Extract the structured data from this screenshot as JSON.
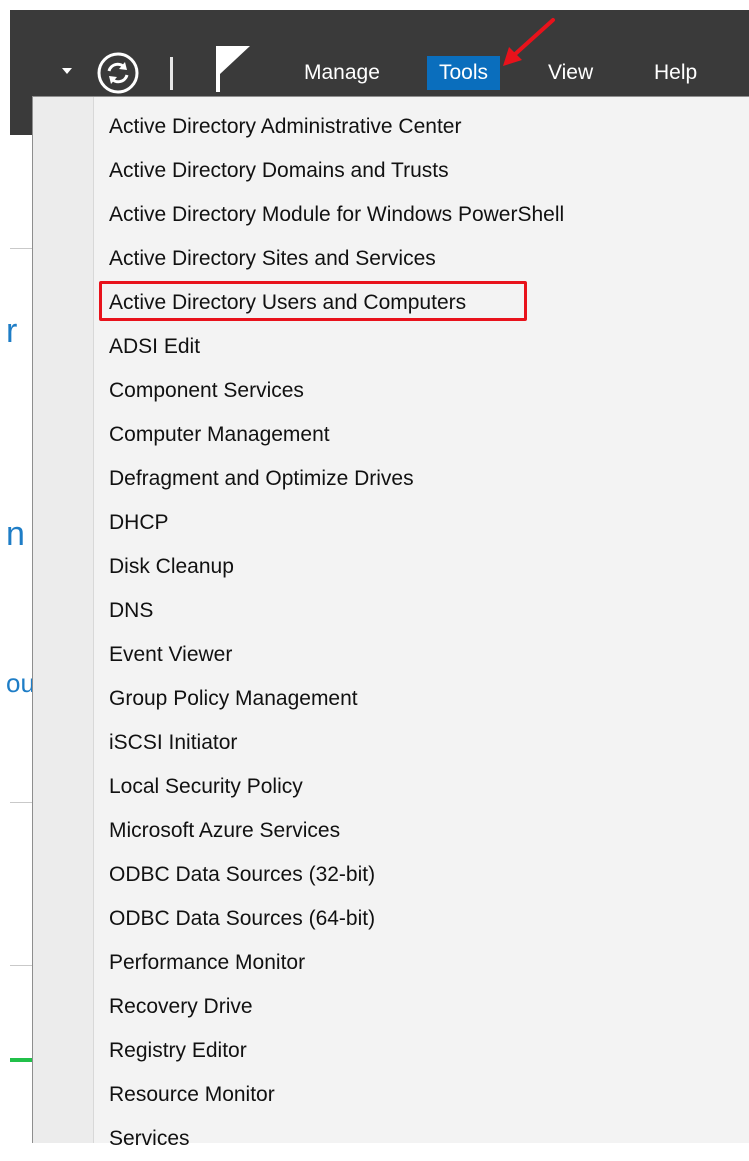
{
  "toolbar": {
    "menus": [
      {
        "label": "Manage"
      },
      {
        "label": "Tools",
        "active": true
      },
      {
        "label": "View"
      },
      {
        "label": "Help"
      }
    ],
    "icons": [
      "dropdown-caret-icon",
      "refresh-icon",
      "flag-icon"
    ]
  },
  "tools_menu": {
    "items": [
      "Active Directory Administrative Center",
      "Active Directory Domains and Trusts",
      "Active Directory Module for Windows PowerShell",
      "Active Directory Sites and Services",
      "Active Directory Users and Computers",
      "ADSI Edit",
      "Component Services",
      "Computer Management",
      "Defragment and Optimize Drives",
      "DHCP",
      "Disk Cleanup",
      "DNS",
      "Event Viewer",
      "Group Policy Management",
      "iSCSI Initiator",
      "Local Security Policy",
      "Microsoft Azure Services",
      "ODBC Data Sources (32-bit)",
      "ODBC Data Sources (64-bit)",
      "Performance Monitor",
      "Recovery Drive",
      "Registry Editor",
      "Resource Monitor",
      "Services"
    ],
    "highlighted_item": "Active Directory Users and Computers"
  },
  "background_fragments": [
    "r",
    "n",
    "ou"
  ],
  "colors": {
    "toolbar_bg": "#3a3a3a",
    "active_menu_bg": "#0a6ebd",
    "menu_bg": "#f3f3f3",
    "highlight_border": "#e8121b",
    "annotation_arrow": "#e8121b"
  }
}
